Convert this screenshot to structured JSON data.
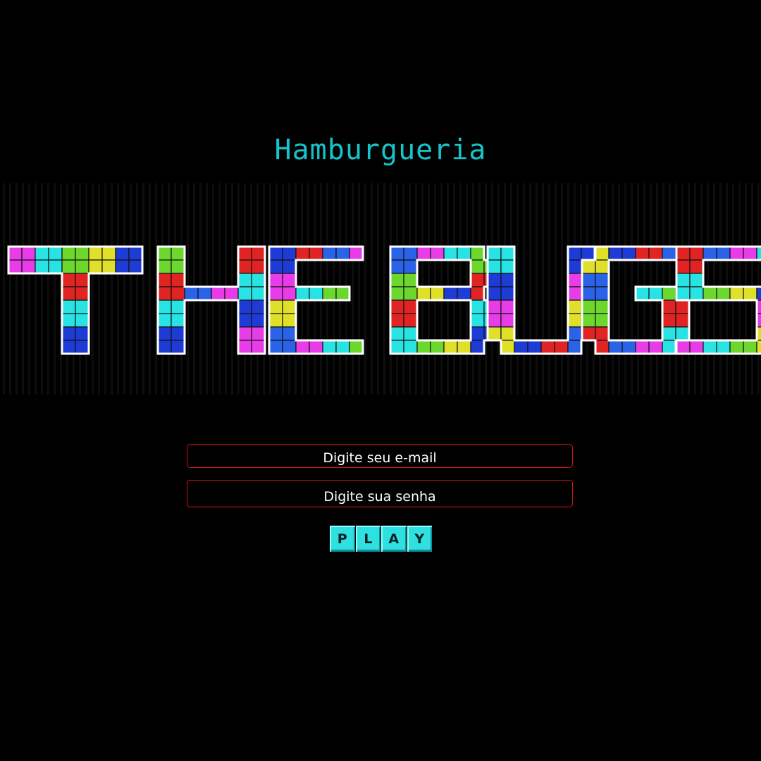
{
  "header": {
    "subtitle": "Hamburgueria",
    "subtitle_color": "#17c3c9"
  },
  "logo": {
    "text": "THE BUGS",
    "letters": [
      "T",
      "H",
      "E",
      "B",
      "U",
      "G",
      "S"
    ],
    "block_colors": [
      "#e83ce8",
      "#27e3e3",
      "#6cd82e",
      "#e0e02a",
      "#1f3bd6",
      "#e02424",
      "#2a62e8"
    ],
    "outline_color": "#ffffff"
  },
  "login": {
    "email_placeholder": "Digite seu e-mail",
    "password_placeholder": "Digite sua senha",
    "field_border_color": "#d01515"
  },
  "play_button": {
    "label": "PLAY",
    "keys": [
      "P",
      "L",
      "A",
      "Y"
    ],
    "color": "#2fe0e0"
  }
}
